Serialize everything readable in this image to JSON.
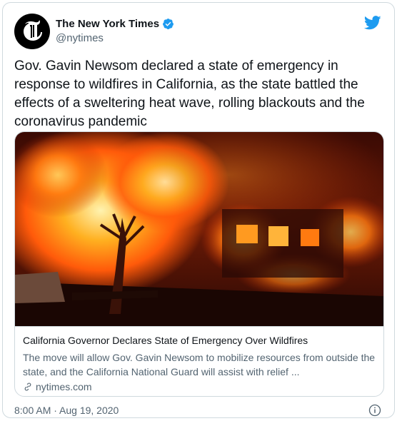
{
  "author": {
    "name": "The New York Times",
    "handle": "@nytimes",
    "verified": true
  },
  "tweet": {
    "text": "Gov. Gavin Newsom declared a state of emergency in\nresponse to wildfires in California, as the state battled the\neffects of a sweltering heat wave, rolling blackouts and the\ncoronavirus pandemic",
    "timestamp": "8:00 AM · Aug 19, 2020"
  },
  "link_card": {
    "headline": "California Governor Declares State of Emergency Over Wildfires",
    "description": "The move will allow Gov. Gavin Newsom to mobilize resources from outside the state, and the California National Guard will assist with relief ...",
    "domain": "nytimes.com"
  },
  "colors": {
    "twitter_blue": "#1d9bf0",
    "text_primary": "#0f1419",
    "text_secondary": "#536471",
    "border": "#cfd9de"
  },
  "icons": [
    "nyt-logo-icon",
    "verified-badge-icon",
    "twitter-bird-icon",
    "link-icon",
    "info-icon"
  ]
}
